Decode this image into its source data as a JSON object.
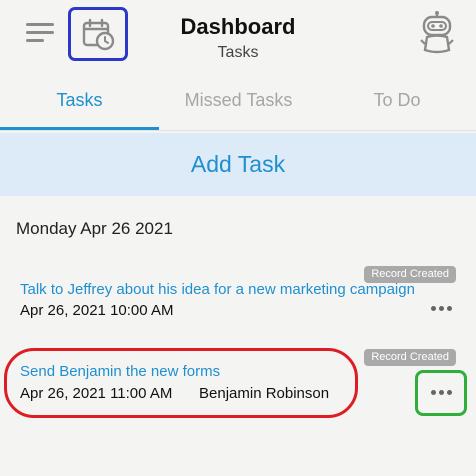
{
  "header": {
    "title": "Dashboard",
    "subtitle": "Tasks",
    "menu_icon": "hamburger-menu-icon",
    "calendar_icon": "calendar-clock-icon",
    "robot_icon": "robot-icon"
  },
  "tabs": [
    {
      "label": "Tasks",
      "active": true
    },
    {
      "label": "Missed Tasks",
      "active": false
    },
    {
      "label": "To Do",
      "active": false
    }
  ],
  "add_task_label": "Add Task",
  "date_header": "Monday Apr 26 2021",
  "tasks": [
    {
      "title": "Talk to Jeffrey about his idea for a new marketing campaign",
      "datetime": "Apr 26, 2021 10:00 AM",
      "assignee": "",
      "badge": "Record Created"
    },
    {
      "title": "Send Benjamin the new forms",
      "datetime": "Apr 26, 2021 11:00 AM",
      "assignee": "Benjamin Robinson",
      "badge": "Record Created"
    }
  ],
  "colors": {
    "accent": "#1f8fd0",
    "add_task_bg": "#dcebf7",
    "badge_bg": "#a9a9a9",
    "highlight_blue": "#2b38c8",
    "highlight_red": "#de1c24",
    "highlight_green": "#2fae3b"
  }
}
